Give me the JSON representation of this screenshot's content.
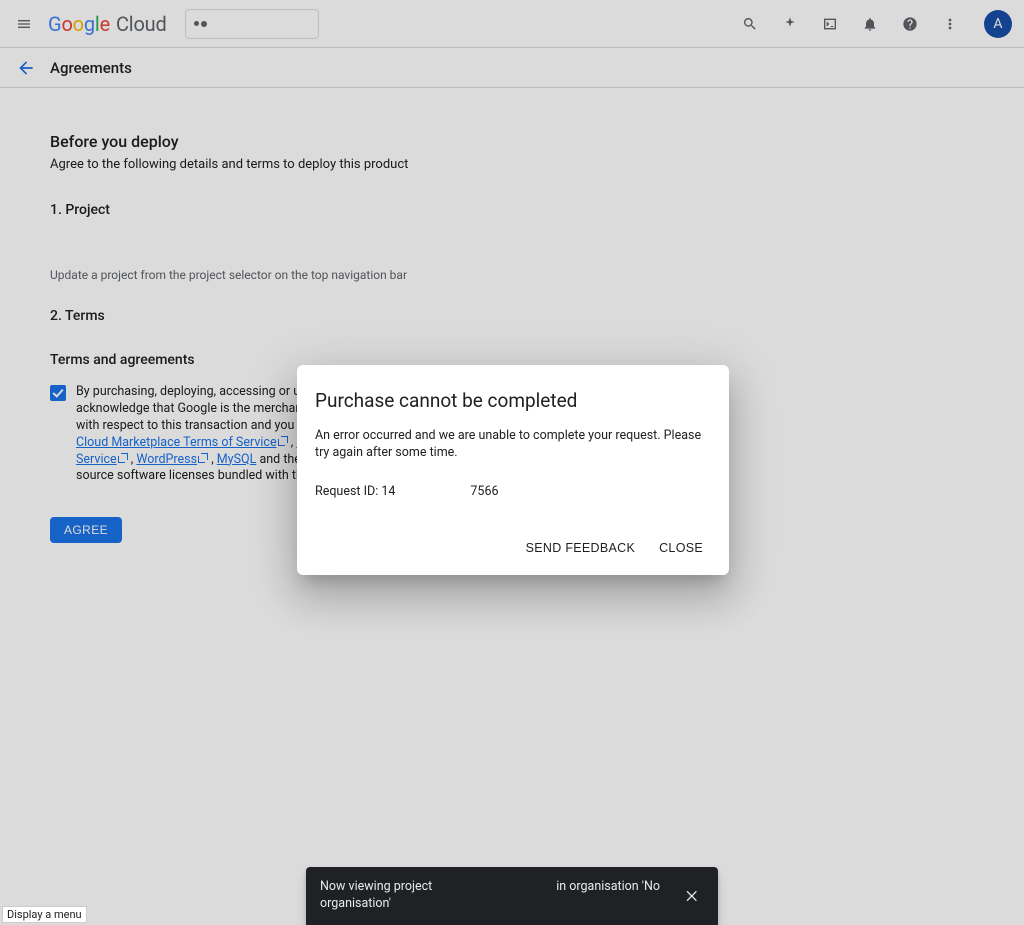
{
  "header": {
    "brand": {
      "google": "Google",
      "cloud": "Cloud"
    },
    "avatar_initial": "A"
  },
  "subheader": {
    "title": "Agreements"
  },
  "content": {
    "before_heading": "Before you deploy",
    "before_text": "Agree to the following details and terms to deploy this product",
    "section1": "1. Project",
    "project_hint": "Update a project from the project selector on the top navigation bar",
    "section2": "2. Terms",
    "terms_heading": "Terms and agreements",
    "terms_pre": "By purchasing, deploying, accessing or using this product, you acknowledge that Google is the merchant of record and Vendor's reseller with respect to this transaction and you agree to comply with the ",
    "link1": "Google Cloud Marketplace Terms of Service",
    "sep": " , ",
    "link2": "Google Click to Deploy Terms of Service",
    "link3": "WordPress",
    "link4": "MySQL",
    "terms_post": " and the terms of applicable open-source software licenses bundled with the software or VM.",
    "agree_label": "AGREE"
  },
  "modal": {
    "title": "Purchase cannot be completed",
    "body": "An error occurred and we are unable to complete your request. Please try again after some time.",
    "request_id_label": "Request ID: ",
    "request_id_left": "14",
    "request_id_right": "7566",
    "feedback_label": "SEND FEEDBACK",
    "close_label": "CLOSE"
  },
  "snackbar": {
    "left": "Now viewing project organisation'",
    "right": "in organisation 'No"
  },
  "tooltip": {
    "text": "Display a menu"
  }
}
